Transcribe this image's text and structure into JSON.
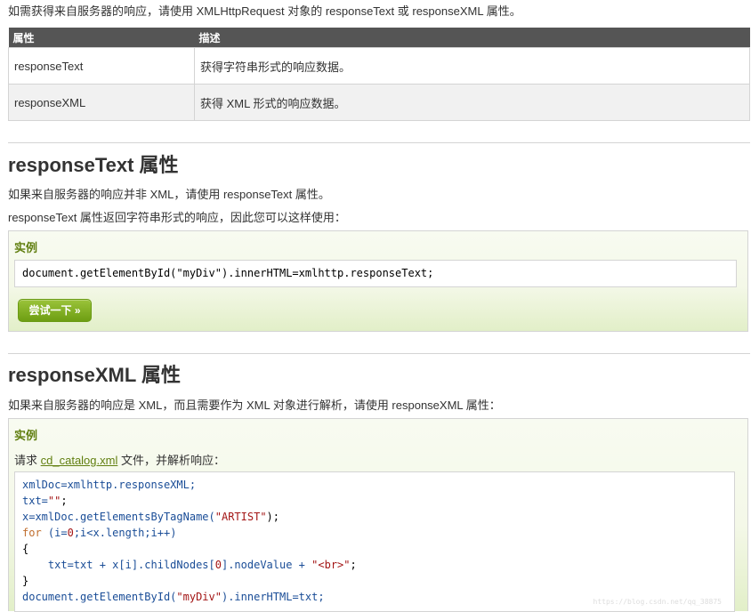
{
  "intro": "如需获得来自服务器的响应，请使用 XMLHttpRequest 对象的 responseText 或 responseXML 属性。",
  "table": {
    "headers": [
      "属性",
      "描述"
    ],
    "rows": [
      [
        "responseText",
        "获得字符串形式的响应数据。"
      ],
      [
        "responseXML",
        "获得 XML 形式的响应数据。"
      ]
    ]
  },
  "section1": {
    "title": "responseText 属性",
    "p1": "如果来自服务器的响应并非 XML，请使用 responseText 属性。",
    "p2": "responseText 属性返回字符串形式的响应，因此您可以这样使用：",
    "example_title": "实例",
    "code": "document.getElementById(\"myDiv\").innerHTML=xmlhttp.responseText;",
    "try_button": "尝试一下 »"
  },
  "section2": {
    "title": "responseXML 属性",
    "p1": "如果来自服务器的响应是 XML，而且需要作为 XML 对象进行解析，请使用 responseXML 属性：",
    "example_title": "实例",
    "request_prefix": "请求",
    "request_link": "cd_catalog.xml",
    "request_suffix": "文件，并解析响应：",
    "code": {
      "l1_a": "xmlDoc=xmlhttp.responseXML;",
      "l2_a": "txt=",
      "l2_b": "\"\"",
      "l2_c": ";",
      "l3_a": "x=xmlDoc.getElementsByTagName(",
      "l3_b": "\"ARTIST\"",
      "l3_c": ");",
      "l4_kw": "for",
      "l4_a": " (i=",
      "l4_b": "0",
      "l4_c": ";i<x.length;i++)",
      "l5": "{",
      "l6_a": "    txt=txt + x[i].childNodes[",
      "l6_b": "0",
      "l6_c": "].nodeValue + ",
      "l6_d": "\"<br>\"",
      "l6_e": ";",
      "l7": "}",
      "l8_a": "document.getElementById(",
      "l8_b": "\"myDiv\"",
      "l8_c": ").innerHTML=txt;"
    }
  },
  "watermark": "https://blog.csdn.net/qq_38875"
}
